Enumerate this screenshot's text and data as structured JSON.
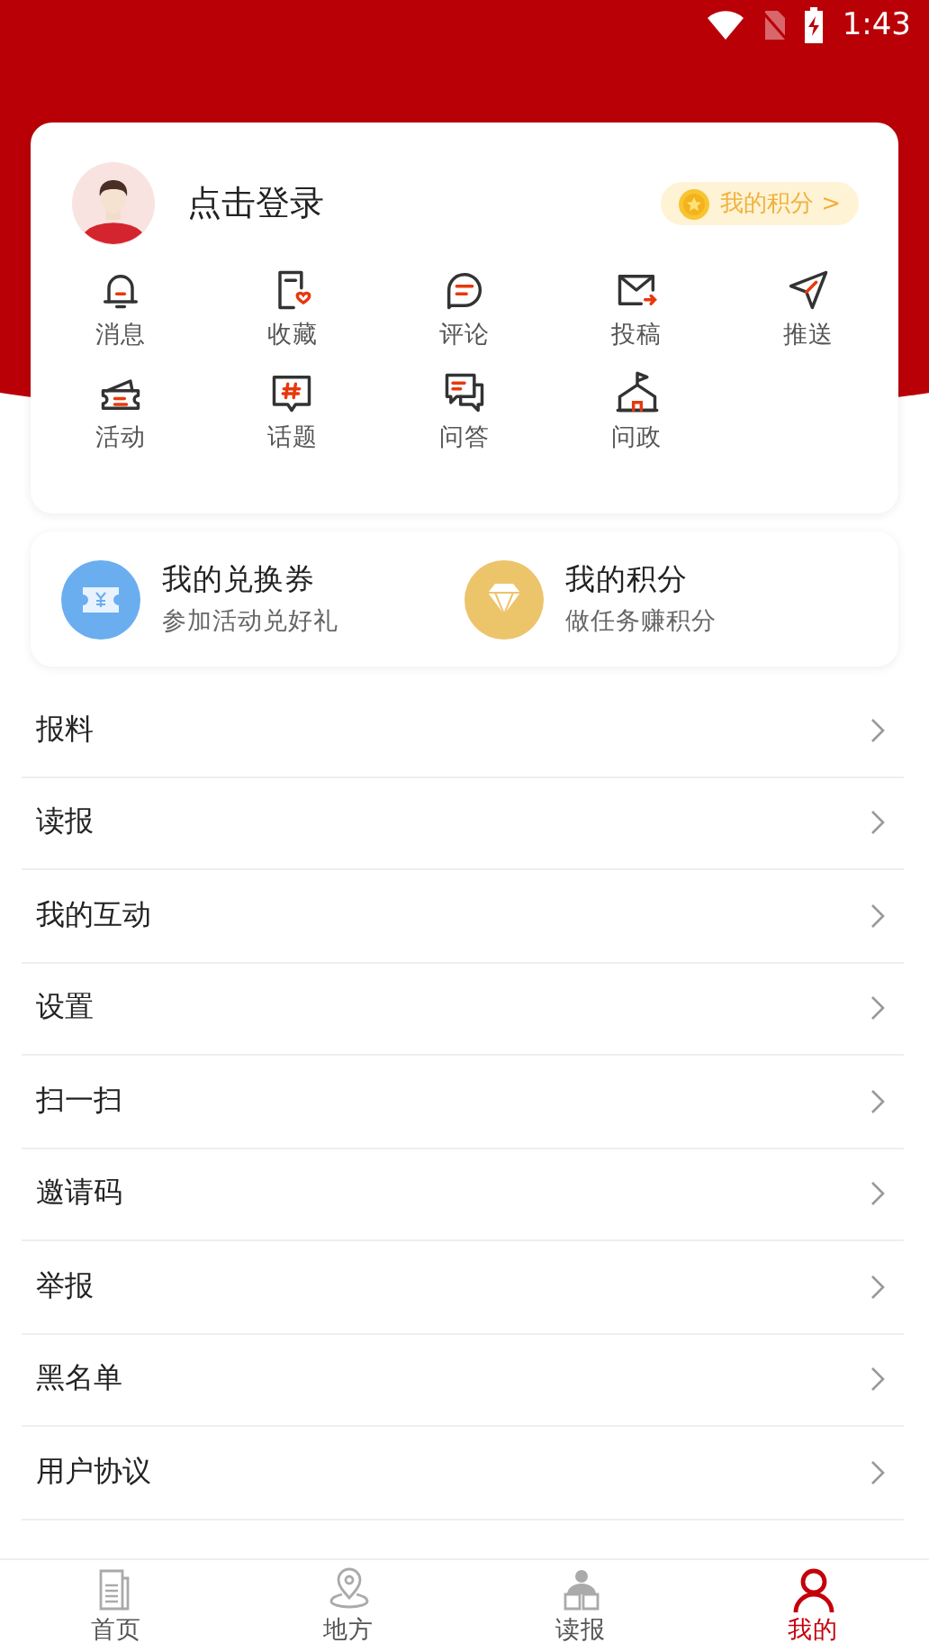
{
  "status_bar": {
    "time": "1:43"
  },
  "profile": {
    "login_text": "点击登录",
    "points_badge": "我的积分 >"
  },
  "shortcuts": [
    {
      "label": "消息"
    },
    {
      "label": "收藏"
    },
    {
      "label": "评论"
    },
    {
      "label": "投稿"
    },
    {
      "label": "推送"
    },
    {
      "label": "活动"
    },
    {
      "label": "话题"
    },
    {
      "label": "问答"
    },
    {
      "label": "问政"
    }
  ],
  "wallet": [
    {
      "title": "我的兑换券",
      "subtitle": "参加活动兑好礼"
    },
    {
      "title": "我的积分",
      "subtitle": "做任务赚积分"
    }
  ],
  "menu": [
    {
      "label": "报料"
    },
    {
      "label": "读报"
    },
    {
      "label": "我的互动"
    },
    {
      "label": "设置"
    },
    {
      "label": "扫一扫"
    },
    {
      "label": "邀请码"
    },
    {
      "label": "举报"
    },
    {
      "label": "黑名单"
    },
    {
      "label": "用户协议"
    }
  ],
  "bottom_nav": [
    {
      "label": "首页",
      "selected": false
    },
    {
      "label": "地方",
      "selected": false
    },
    {
      "label": "读报",
      "selected": false
    },
    {
      "label": "我的",
      "selected": true
    }
  ]
}
